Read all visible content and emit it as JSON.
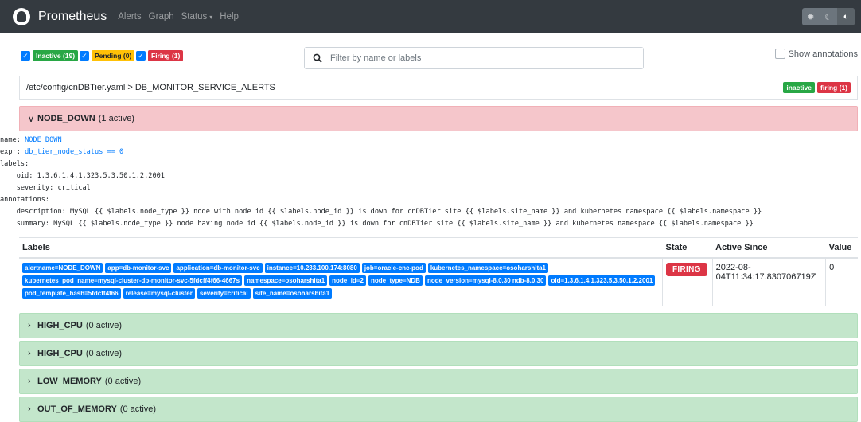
{
  "navbar": {
    "brand": "Prometheus",
    "links": [
      "Alerts",
      "Graph",
      "Status",
      "Help"
    ],
    "status_caret": "▾",
    "theme_buttons": [
      "light-theme",
      "dark-theme",
      "auto-theme"
    ]
  },
  "filters": {
    "inactive": "Inactive (19)",
    "pending": "Pending (0)",
    "firing": "Firing (1)",
    "search_placeholder": "Filter by name or labels",
    "show_annotations": "Show annotations"
  },
  "file": {
    "path": "/etc/config/cnDBTier.yaml > DB_MONITOR_SERVICE_ALERTS",
    "badge_inactive": "inactive",
    "badge_firing": "firing (1)"
  },
  "active_rule": {
    "name": "NODE_DOWN",
    "count": "(1 active)",
    "definition": {
      "name_key": "name:",
      "name_val": "NODE_DOWN",
      "expr_key": "expr:",
      "expr_val": "db_tier_node_status == 0",
      "labels_key": "labels:",
      "oid": "  oid: 1.3.6.1.4.1.323.5.3.50.1.2.2001",
      "severity": "  severity: critical",
      "annotations_key": "annotations:",
      "description": "  description: MySQL {{ $labels.node_type }} node with node id {{ $labels.node_id }} is down for cnDBTier site {{ $labels.site_name }} and kubernetes namespace {{ $labels.namespace }}",
      "summary": "  summary: MySQL {{ $labels.node_type }} node having node id {{ $labels.node_id }} is down for cnDBTier site {{ $labels.site_name }} and kubernetes namespace {{ $labels.namespace }}"
    }
  },
  "table": {
    "headers": {
      "labels": "Labels",
      "state": "State",
      "active_since": "Active Since",
      "value": "Value"
    },
    "row": {
      "labels": [
        "alertname=NODE_DOWN",
        "app=db-monitor-svc",
        "application=db-monitor-svc",
        "instance=10.233.100.174:8080",
        "job=oracle-cnc-pod",
        "kubernetes_namespace=osoharshita1",
        "kubernetes_pod_name=mysql-cluster-db-monitor-svc-5fdcff4f66-4667s",
        "namespace=osoharshita1",
        "node_id=2",
        "node_type=NDB",
        "node_version=mysql-8.0.30 ndb-8.0.30",
        "oid=1.3.6.1.4.1.323.5.3.50.1.2.2001",
        "pod_template_hash=5fdcff4f66",
        "release=mysql-cluster",
        "severity=critical",
        "site_name=osoharshita1"
      ],
      "state": "FIRING",
      "active_since_line1": "2022-08-",
      "active_since_line2": "04T11:34:17.830706719Z",
      "value": "0"
    }
  },
  "inactive_rules": [
    {
      "name": "HIGH_CPU",
      "count": "(0 active)"
    },
    {
      "name": "HIGH_CPU",
      "count": "(0 active)"
    },
    {
      "name": "LOW_MEMORY",
      "count": "(0 active)"
    },
    {
      "name": "OUT_OF_MEMORY",
      "count": "(0 active)"
    }
  ],
  "colors": {
    "navbar": "#343a40",
    "firing": "#dc3545",
    "inactive": "#28a745",
    "pending": "#ffc107",
    "label": "#007bff"
  }
}
